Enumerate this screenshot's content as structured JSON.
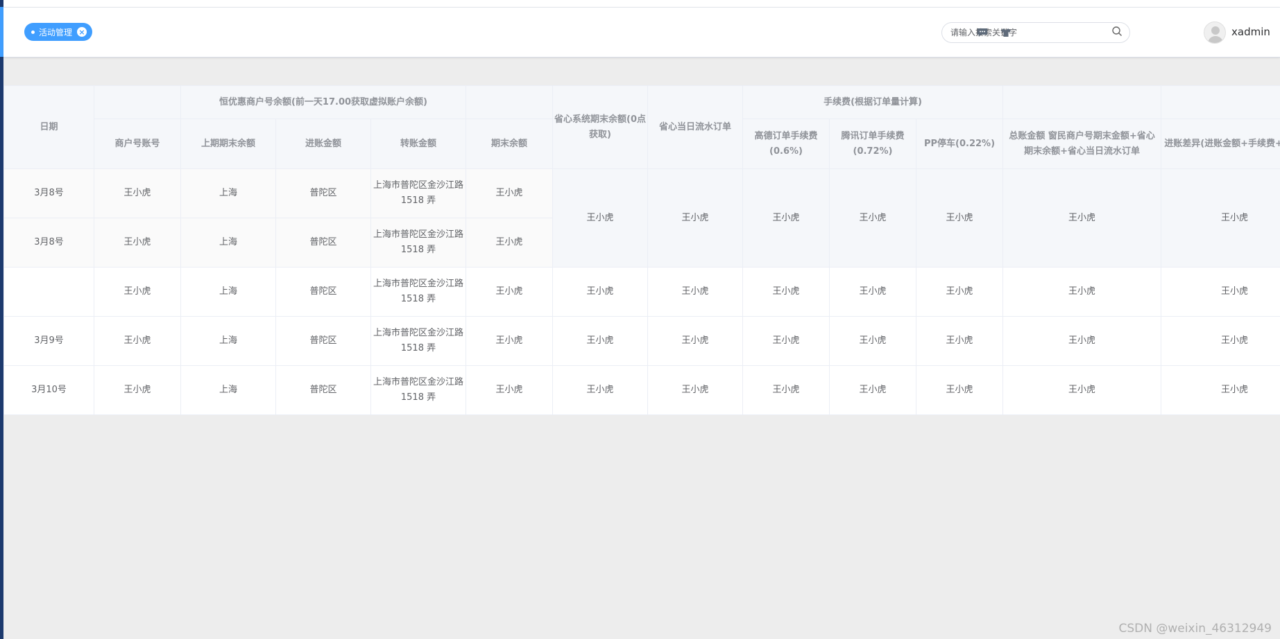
{
  "tags": {
    "active": "活动管理"
  },
  "search": {
    "placeholder": "请输入搜索关键字"
  },
  "user": {
    "name": "xadmin"
  },
  "table": {
    "col_date": "日期",
    "group_merchant": "恒优惠商户号余额(前一天17.00获取虚拟账户余额)",
    "col_merchant_account": "商户号账号",
    "col_prev_balance": "上期期末余额",
    "col_in_amount": "进账金额",
    "col_transfer_amount": "转账金额",
    "col_end_balance": "期末余额",
    "col_system_end_balance": "省心系统期末余额(0点获取)",
    "col_daily_flow": "省心当日流水订单",
    "group_fee": "手续费(根据订单量计算)",
    "col_gaode_fee": "高德订单手续费(0.6%)",
    "col_tencent_fee": "腾讯订单手续费(0.72%)",
    "col_pp_fee": "PP停车(0.22%)",
    "col_total": "总账金额 窗民商户号期末金额+省心期末余额+省心当日流水订单",
    "col_diff": "进账差异(进账金额+手续费+转账)",
    "rows": [
      {
        "date": "3月8号",
        "account": "王小虎",
        "prev": "上海",
        "in": "普陀区",
        "transfer": "上海市普陀区金沙江路 1518 弄",
        "end": "王小虎"
      },
      {
        "date": "3月8号",
        "account": "王小虎",
        "prev": "上海",
        "in": "普陀区",
        "transfer": "上海市普陀区金沙江路 1518 弄",
        "end": "王小虎"
      },
      {
        "date": "",
        "account": "王小虎",
        "prev": "上海",
        "in": "普陀区",
        "transfer": "上海市普陀区金沙江路 1518 弄",
        "end": "王小虎",
        "sys": "王小虎",
        "flow": "王小虎",
        "gaode": "王小虎",
        "tencent": "王小虎",
        "pp": "王小虎",
        "total": "王小虎",
        "diff": "王小虎"
      },
      {
        "date": "3月9号",
        "account": "王小虎",
        "prev": "上海",
        "in": "普陀区",
        "transfer": "上海市普陀区金沙江路 1518 弄",
        "end": "王小虎",
        "sys": "王小虎",
        "flow": "王小虎",
        "gaode": "王小虎",
        "tencent": "王小虎",
        "pp": "王小虎",
        "total": "王小虎",
        "diff": "王小虎"
      },
      {
        "date": "3月10号",
        "account": "王小虎",
        "prev": "上海",
        "in": "普陀区",
        "transfer": "上海市普陀区金沙江路 1518 弄",
        "end": "王小虎",
        "sys": "王小虎",
        "flow": "王小虎",
        "gaode": "王小虎",
        "tencent": "王小虎",
        "pp": "王小虎",
        "total": "王小虎",
        "diff": "王小虎"
      }
    ],
    "merged": {
      "sys": "王小虎",
      "flow": "王小虎",
      "gaode": "王小虎",
      "tencent": "王小虎",
      "pp": "王小虎",
      "total": "王小虎",
      "diff": "王小虎"
    }
  },
  "watermark": "CSDN @weixin_46312949"
}
